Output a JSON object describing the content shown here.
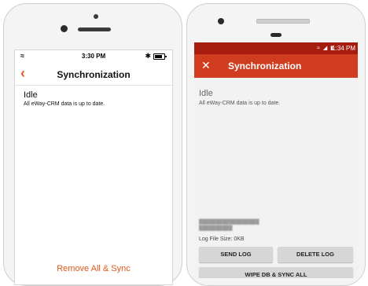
{
  "ios": {
    "status": {
      "time": "3:30 PM",
      "wifi_icon": "wifi-icon",
      "bluetooth_icon": "bluetooth-icon",
      "battery_icon": "battery-icon"
    },
    "nav": {
      "back_icon": "chevron-left-icon",
      "title": "Synchronization"
    },
    "content": {
      "state": "Idle",
      "detail": "All eWay-CRM data is up to date."
    },
    "actions": {
      "remove_all_sync": "Remove All & Sync"
    },
    "accent_color": "#e4571b"
  },
  "android": {
    "status": {
      "time": "1:34 PM",
      "icons": "wifi-icon signal-icon battery-icon"
    },
    "appbar": {
      "close_icon": "close-icon",
      "title": "Synchronization"
    },
    "content": {
      "state": "Idle",
      "detail": "All eWay-CRM data is up to date.",
      "log_file_size": "Log File Size: 0KB"
    },
    "buttons": {
      "send_log": "SEND LOG",
      "delete_log": "DELETE LOG",
      "wipe_db": "WIPE DB & SYNC ALL"
    },
    "status_bar_color": "#a61d10",
    "appbar_color": "#d03d1e"
  }
}
